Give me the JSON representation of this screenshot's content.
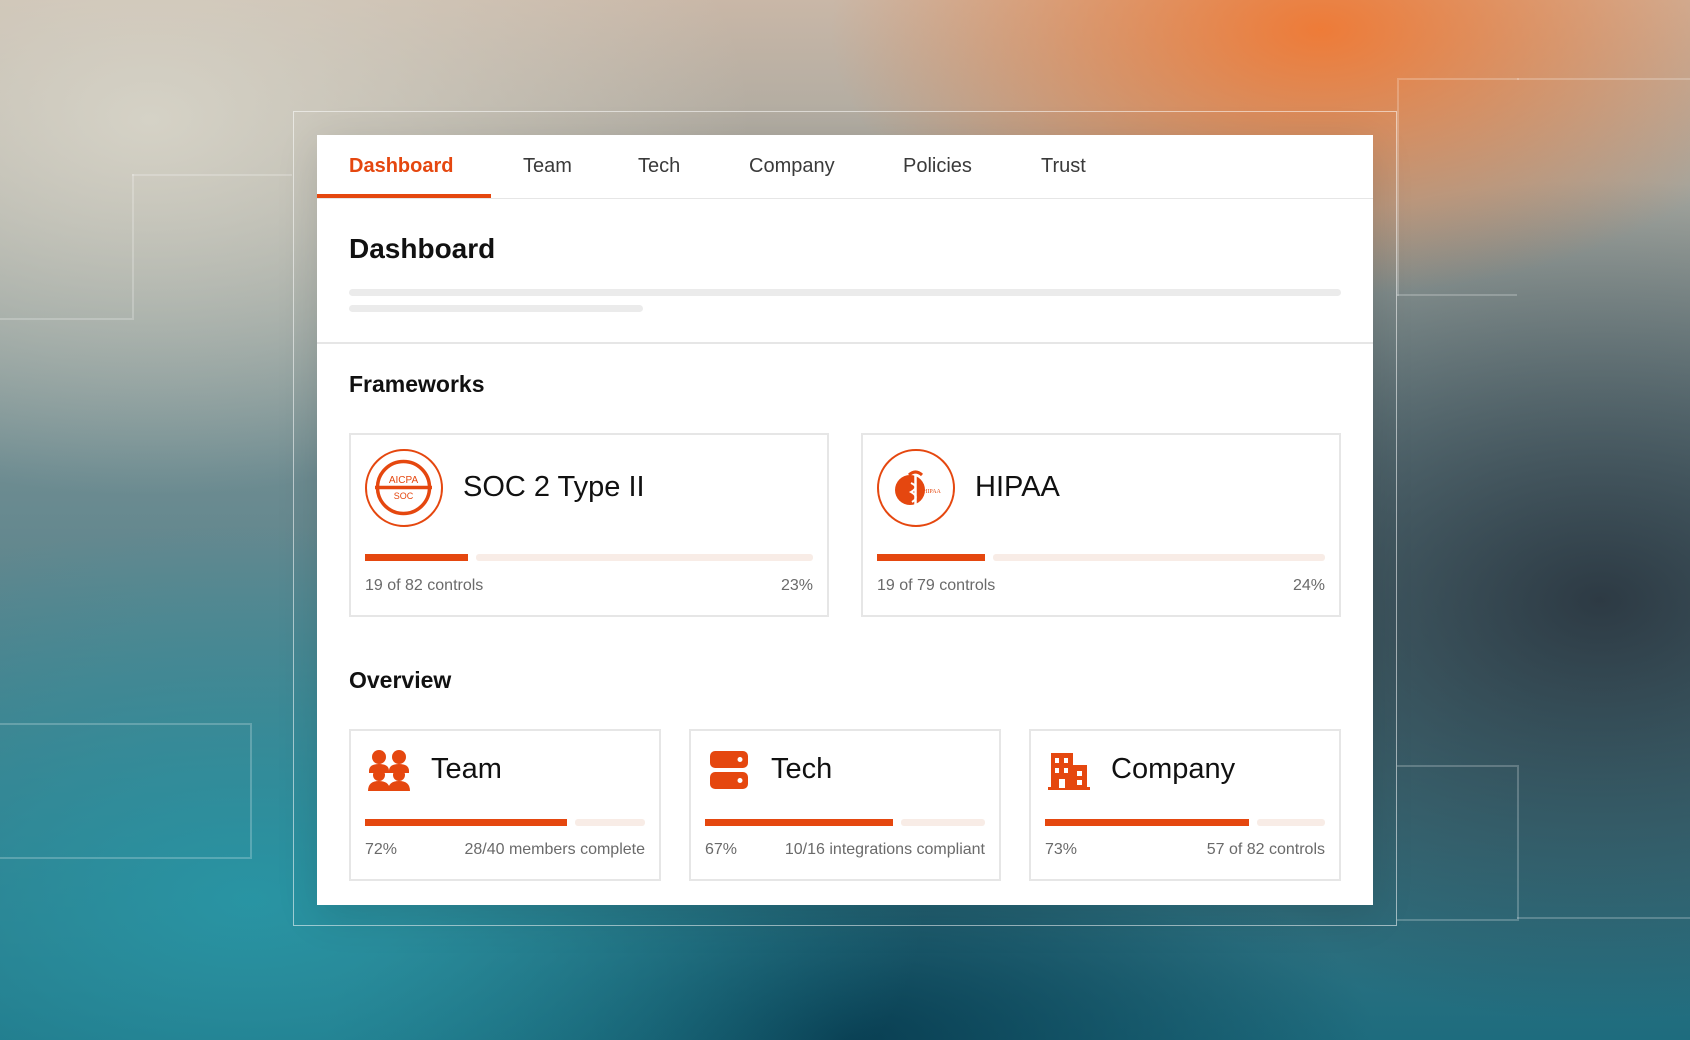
{
  "colors": {
    "accent": "#e5470f",
    "track": "#f8ece6"
  },
  "tabs": [
    {
      "label": "Dashboard",
      "active": true
    },
    {
      "label": "Team"
    },
    {
      "label": "Tech"
    },
    {
      "label": "Company"
    },
    {
      "label": "Policies"
    },
    {
      "label": "Trust"
    }
  ],
  "page": {
    "title": "Dashboard"
  },
  "frameworks": {
    "title": "Frameworks",
    "items": [
      {
        "name": "SOC 2 Type II",
        "logo": "aicpa-soc-logo",
        "logo_text_top": "AICPA",
        "logo_text_bottom": "SOC",
        "controls": "19 of 82 controls",
        "percent": "23%",
        "progress": 0.23
      },
      {
        "name": "HIPAA",
        "logo": "hipaa-caduceus-logo",
        "logo_text": "HIPAA",
        "controls": "19 of 79 controls",
        "percent": "24%",
        "progress": 0.24
      }
    ]
  },
  "overview": {
    "title": "Overview",
    "items": [
      {
        "name": "Team",
        "icon": "team-icon",
        "percent": "72%",
        "detail": "28/40 members complete",
        "progress": 0.72
      },
      {
        "name": "Tech",
        "icon": "server-icon",
        "percent": "67%",
        "detail": "10/16 integrations compliant",
        "progress": 0.67
      },
      {
        "name": "Company",
        "icon": "building-icon",
        "percent": "73%",
        "detail": "57 of 82 controls",
        "progress": 0.73
      }
    ]
  }
}
